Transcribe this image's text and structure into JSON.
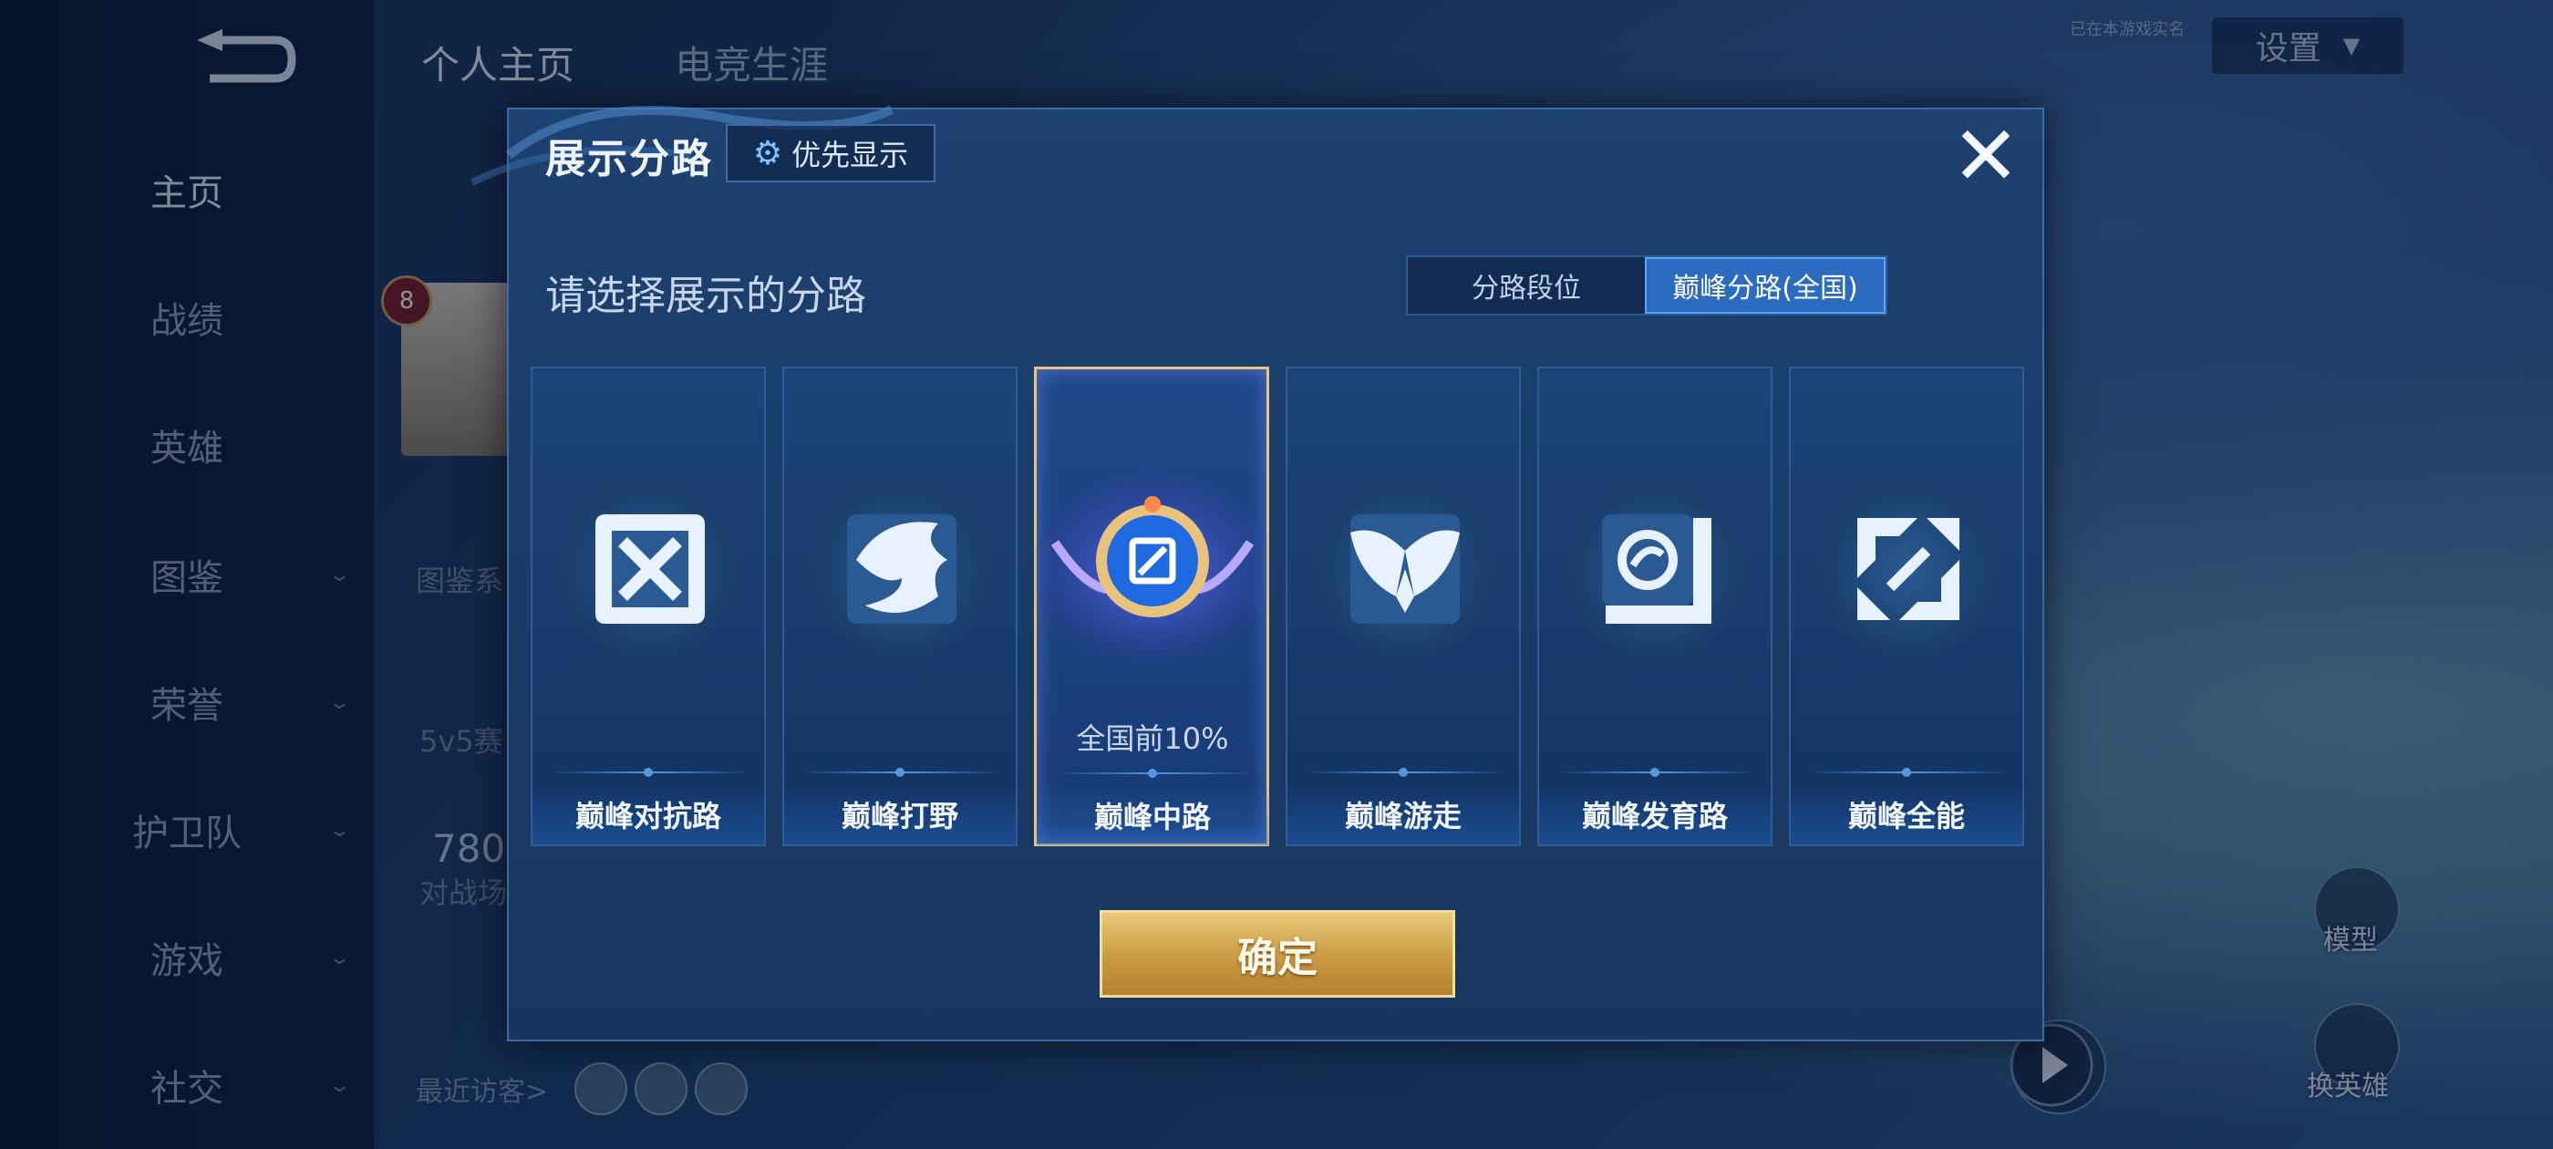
{
  "sidebar": {
    "items": [
      {
        "label": "主页",
        "active": true,
        "chevron": false
      },
      {
        "label": "战绩",
        "active": false,
        "chevron": false
      },
      {
        "label": "英雄",
        "active": false,
        "chevron": false
      },
      {
        "label": "图鉴",
        "active": false,
        "chevron": true
      },
      {
        "label": "荣誉",
        "active": false,
        "chevron": true
      },
      {
        "label": "护卫队",
        "active": false,
        "chevron": true
      },
      {
        "label": "游戏",
        "active": false,
        "chevron": true
      },
      {
        "label": "社交",
        "active": false,
        "chevron": true
      }
    ]
  },
  "header": {
    "tabs": [
      {
        "label": "个人主页",
        "active": true
      },
      {
        "label": "电竞生涯",
        "active": false
      }
    ],
    "settings_label": "设置",
    "small_note": "已在本游戏实名"
  },
  "profile": {
    "level": "8",
    "faded_texts": [
      "图鉴系",
      "5v5赛",
      "780",
      "对战场"
    ],
    "visitors_label": "最近访客>"
  },
  "right_panel": {
    "labels": [
      "模型",
      "换英雄"
    ]
  },
  "modal": {
    "title": "展示分路",
    "priority_button": "优先显示",
    "close_icon": "close-icon",
    "subtitle": "请选择展示的分路",
    "segment_tabs": [
      {
        "label": "分路段位",
        "active": false
      },
      {
        "label": "巅峰分路(全国)",
        "active": true
      }
    ],
    "lanes": [
      {
        "name": "巅峰对抗路",
        "icon": "clash-lane-icon",
        "selected": false,
        "rank": ""
      },
      {
        "name": "巅峰打野",
        "icon": "jungle-dragon-icon",
        "selected": false,
        "rank": ""
      },
      {
        "name": "巅峰中路",
        "icon": "mid-lane-badge-icon",
        "selected": true,
        "rank": "全国前10%"
      },
      {
        "name": "巅峰游走",
        "icon": "roam-wings-icon",
        "selected": false,
        "rank": ""
      },
      {
        "name": "巅峰发育路",
        "icon": "farm-lane-icon",
        "selected": false,
        "rank": ""
      },
      {
        "name": "巅峰全能",
        "icon": "all-round-icon",
        "selected": false,
        "rank": ""
      }
    ],
    "confirm_button": "确定"
  },
  "colors": {
    "accent_blue": "#2b6bc0",
    "selected_border": "#e7c37e",
    "confirm_gold": "#c99a42",
    "modal_bg": "#1d4170"
  }
}
